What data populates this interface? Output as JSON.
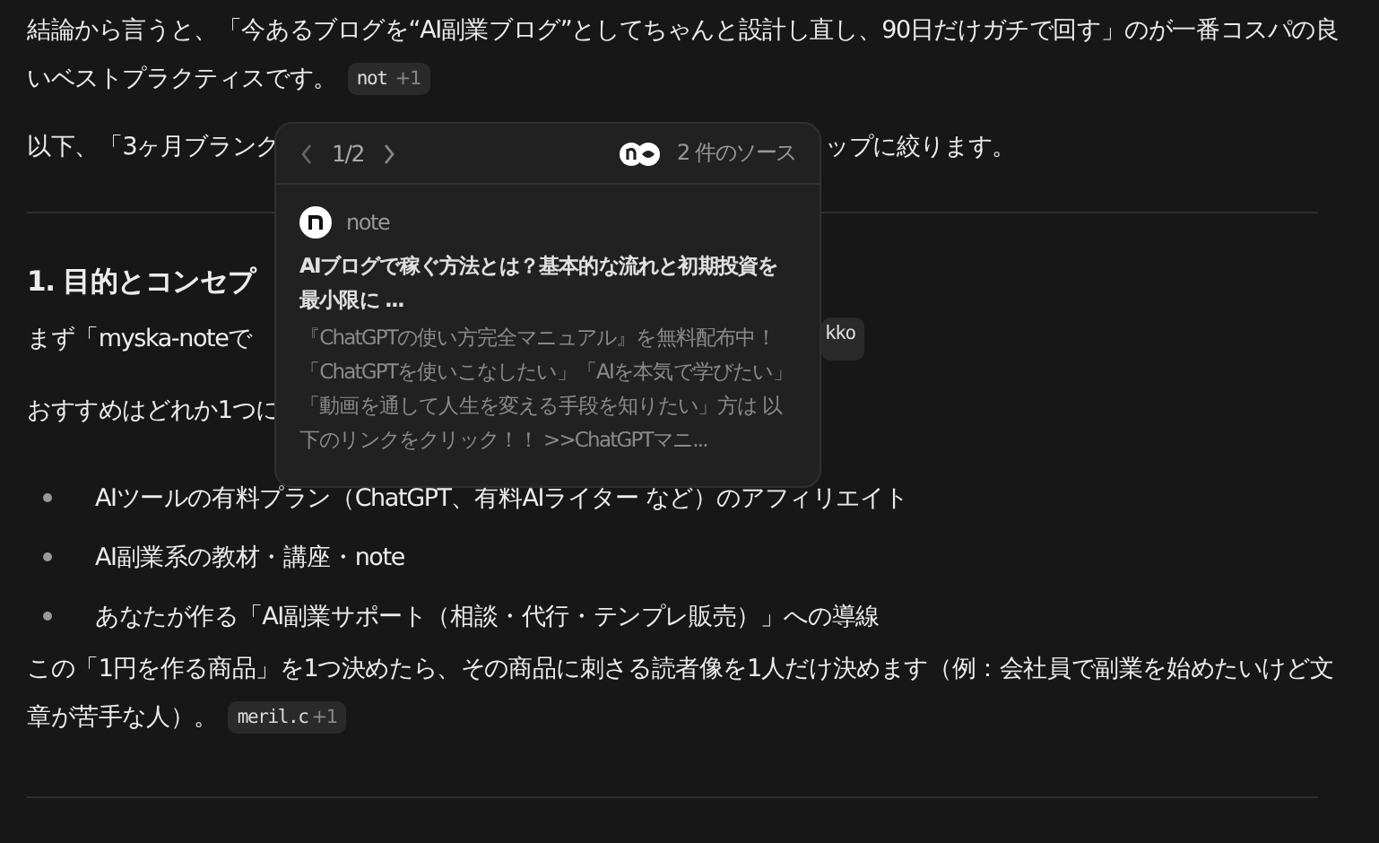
{
  "intro": {
    "text": "結論から言うと、「今あるブログを“AI副業ブログ”としてちゃんと設計し直し、90日だけガチで回す」のが一番コスパの良いベストプラクティスです。",
    "citation": {
      "label": "not",
      "more": "+1"
    }
  },
  "partial_line": {
    "left": "以下、「3ヶ月ブランク",
    "right": "ップに絞ります。"
  },
  "heading": "1. 目的とコンセプ",
  "line_2": {
    "left": "まず「myska-noteで",
    "citation_fragment": "kko"
  },
  "line_3": "おすすめはどれか1つに",
  "bullets": [
    "AIツールの有料プラン（ChatGPT、有料AIライター など）のアフィリエイト",
    "AI副業系の教材・講座・note",
    "あなたが作る「AI副業サポート（相談・代行・テンプレ販売）」への導線"
  ],
  "closing": {
    "text": "この「1円を作る商品」を1つ決めたら、その商品に刺さる読者像を1人だけ決めます（例：会社員で副業を始めたいけど文章が苦手な人）。",
    "citation": {
      "label": "meril.c",
      "more": "+1"
    }
  },
  "popover": {
    "page": "1/2",
    "sources_label": "2 件のソース",
    "source": {
      "site": "note",
      "title": "AIブログで稼ぐ方法とは？基本的な流れと初期投資を最小限に ...",
      "snippet": "『ChatGPTの使い方完全マニュアル』を無料配布中！「ChatGPTを使いこなしたい」「AIを本気で学びたい」「動画を通して人生を変える手段を知りたい」方は 以下のリンクをクリック！！ >>ChatGPTマニ..."
    }
  }
}
